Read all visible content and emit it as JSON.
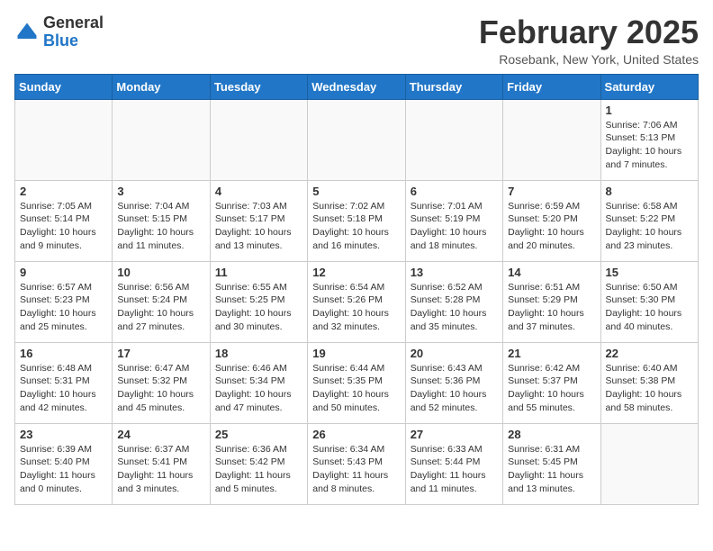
{
  "header": {
    "logo": {
      "general": "General",
      "blue": "Blue"
    },
    "month": "February 2025",
    "location": "Rosebank, New York, United States"
  },
  "weekdays": [
    "Sunday",
    "Monday",
    "Tuesday",
    "Wednesday",
    "Thursday",
    "Friday",
    "Saturday"
  ],
  "weeks": [
    [
      {
        "day": "",
        "info": ""
      },
      {
        "day": "",
        "info": ""
      },
      {
        "day": "",
        "info": ""
      },
      {
        "day": "",
        "info": ""
      },
      {
        "day": "",
        "info": ""
      },
      {
        "day": "",
        "info": ""
      },
      {
        "day": "1",
        "info": "Sunrise: 7:06 AM\nSunset: 5:13 PM\nDaylight: 10 hours and 7 minutes."
      }
    ],
    [
      {
        "day": "2",
        "info": "Sunrise: 7:05 AM\nSunset: 5:14 PM\nDaylight: 10 hours and 9 minutes."
      },
      {
        "day": "3",
        "info": "Sunrise: 7:04 AM\nSunset: 5:15 PM\nDaylight: 10 hours and 11 minutes."
      },
      {
        "day": "4",
        "info": "Sunrise: 7:03 AM\nSunset: 5:17 PM\nDaylight: 10 hours and 13 minutes."
      },
      {
        "day": "5",
        "info": "Sunrise: 7:02 AM\nSunset: 5:18 PM\nDaylight: 10 hours and 16 minutes."
      },
      {
        "day": "6",
        "info": "Sunrise: 7:01 AM\nSunset: 5:19 PM\nDaylight: 10 hours and 18 minutes."
      },
      {
        "day": "7",
        "info": "Sunrise: 6:59 AM\nSunset: 5:20 PM\nDaylight: 10 hours and 20 minutes."
      },
      {
        "day": "8",
        "info": "Sunrise: 6:58 AM\nSunset: 5:22 PM\nDaylight: 10 hours and 23 minutes."
      }
    ],
    [
      {
        "day": "9",
        "info": "Sunrise: 6:57 AM\nSunset: 5:23 PM\nDaylight: 10 hours and 25 minutes."
      },
      {
        "day": "10",
        "info": "Sunrise: 6:56 AM\nSunset: 5:24 PM\nDaylight: 10 hours and 27 minutes."
      },
      {
        "day": "11",
        "info": "Sunrise: 6:55 AM\nSunset: 5:25 PM\nDaylight: 10 hours and 30 minutes."
      },
      {
        "day": "12",
        "info": "Sunrise: 6:54 AM\nSunset: 5:26 PM\nDaylight: 10 hours and 32 minutes."
      },
      {
        "day": "13",
        "info": "Sunrise: 6:52 AM\nSunset: 5:28 PM\nDaylight: 10 hours and 35 minutes."
      },
      {
        "day": "14",
        "info": "Sunrise: 6:51 AM\nSunset: 5:29 PM\nDaylight: 10 hours and 37 minutes."
      },
      {
        "day": "15",
        "info": "Sunrise: 6:50 AM\nSunset: 5:30 PM\nDaylight: 10 hours and 40 minutes."
      }
    ],
    [
      {
        "day": "16",
        "info": "Sunrise: 6:48 AM\nSunset: 5:31 PM\nDaylight: 10 hours and 42 minutes."
      },
      {
        "day": "17",
        "info": "Sunrise: 6:47 AM\nSunset: 5:32 PM\nDaylight: 10 hours and 45 minutes."
      },
      {
        "day": "18",
        "info": "Sunrise: 6:46 AM\nSunset: 5:34 PM\nDaylight: 10 hours and 47 minutes."
      },
      {
        "day": "19",
        "info": "Sunrise: 6:44 AM\nSunset: 5:35 PM\nDaylight: 10 hours and 50 minutes."
      },
      {
        "day": "20",
        "info": "Sunrise: 6:43 AM\nSunset: 5:36 PM\nDaylight: 10 hours and 52 minutes."
      },
      {
        "day": "21",
        "info": "Sunrise: 6:42 AM\nSunset: 5:37 PM\nDaylight: 10 hours and 55 minutes."
      },
      {
        "day": "22",
        "info": "Sunrise: 6:40 AM\nSunset: 5:38 PM\nDaylight: 10 hours and 58 minutes."
      }
    ],
    [
      {
        "day": "23",
        "info": "Sunrise: 6:39 AM\nSunset: 5:40 PM\nDaylight: 11 hours and 0 minutes."
      },
      {
        "day": "24",
        "info": "Sunrise: 6:37 AM\nSunset: 5:41 PM\nDaylight: 11 hours and 3 minutes."
      },
      {
        "day": "25",
        "info": "Sunrise: 6:36 AM\nSunset: 5:42 PM\nDaylight: 11 hours and 5 minutes."
      },
      {
        "day": "26",
        "info": "Sunrise: 6:34 AM\nSunset: 5:43 PM\nDaylight: 11 hours and 8 minutes."
      },
      {
        "day": "27",
        "info": "Sunrise: 6:33 AM\nSunset: 5:44 PM\nDaylight: 11 hours and 11 minutes."
      },
      {
        "day": "28",
        "info": "Sunrise: 6:31 AM\nSunset: 5:45 PM\nDaylight: 11 hours and 13 minutes."
      },
      {
        "day": "",
        "info": ""
      }
    ]
  ]
}
